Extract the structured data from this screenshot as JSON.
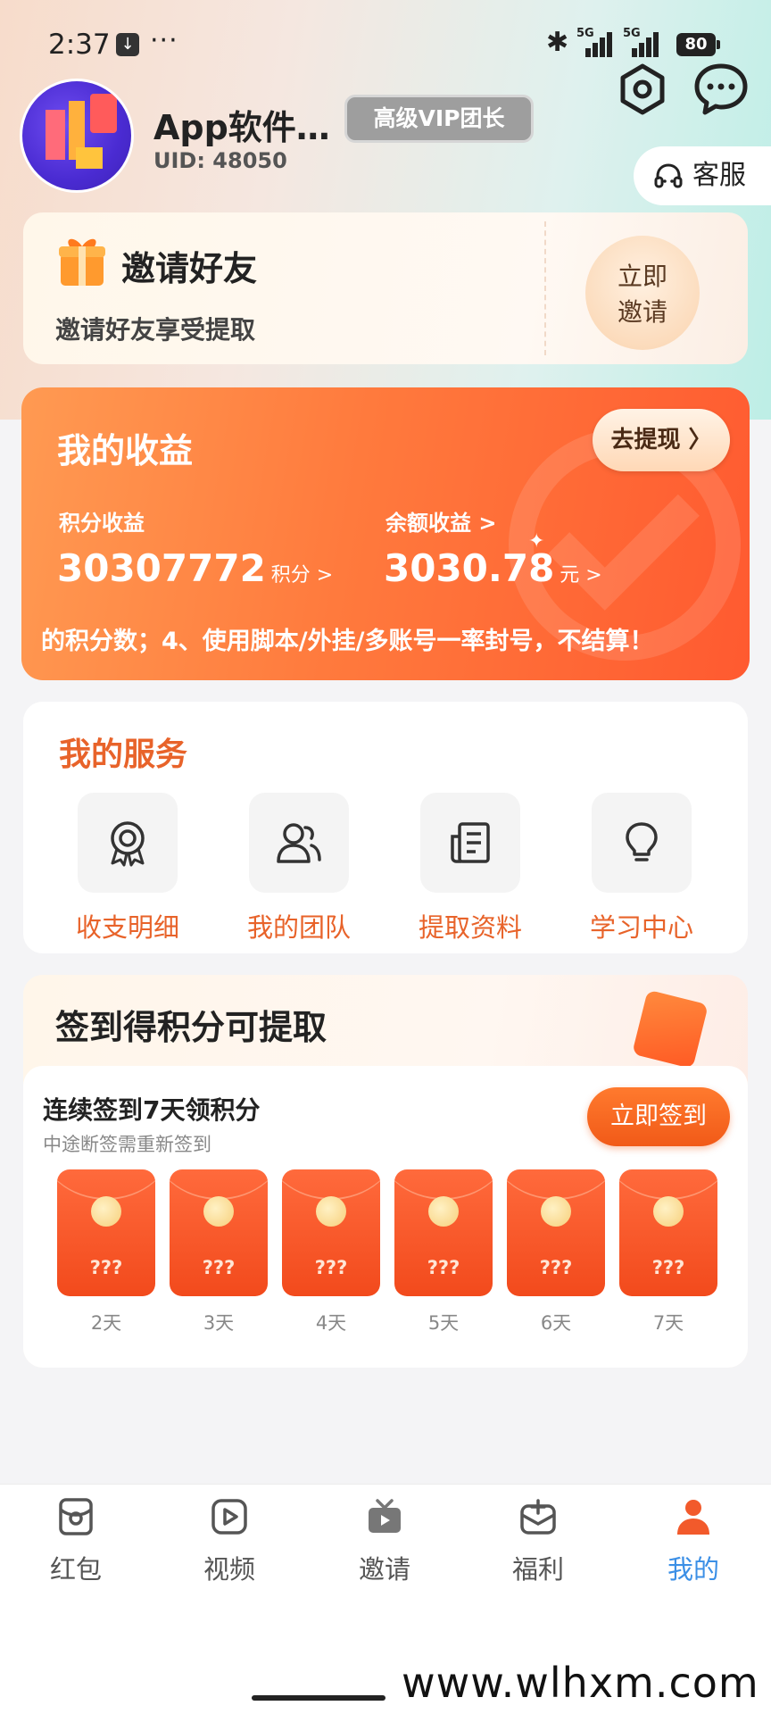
{
  "status_bar": {
    "time": "2:37",
    "download": "↓",
    "dots": "···",
    "bluetooth": "✱",
    "net1": "5G",
    "net2": "5G",
    "battery": "80"
  },
  "header": {
    "username": "App软件…",
    "uid": "UID: 48050",
    "vip_badge": "高级VIP团长",
    "service_label": "客服"
  },
  "invite": {
    "title": "邀请好友",
    "subtitle": "邀请好友享受提取",
    "button_line1": "立即",
    "button_line2": "邀请"
  },
  "earnings": {
    "title": "我的收益",
    "withdraw_label": "去提现 〉",
    "points_label": "积分收益",
    "points_value": "30307772",
    "points_unit": "积分 >",
    "balance_label": "余额收益 >",
    "balance_value": "3030.78",
    "balance_unit": "元 >",
    "marquee": "的积分数；4、使用脚本/外挂/多账号一率封号，不结算！"
  },
  "services": {
    "title": "我的服务",
    "items": [
      {
        "label": "收支明细",
        "icon": "badge-icon"
      },
      {
        "label": "我的团队",
        "icon": "team-icon"
      },
      {
        "label": "提取资料",
        "icon": "document-icon"
      },
      {
        "label": "学习中心",
        "icon": "lightbulb-icon"
      }
    ]
  },
  "signin": {
    "title": "签到得积分可提取",
    "streak_title": "连续签到7天领积分",
    "streak_sub": "中途断签需重新签到",
    "button": "立即签到",
    "days": [
      {
        "mystery": "???",
        "label": "2天"
      },
      {
        "mystery": "???",
        "label": "3天"
      },
      {
        "mystery": "???",
        "label": "4天"
      },
      {
        "mystery": "???",
        "label": "5天"
      },
      {
        "mystery": "???",
        "label": "6天"
      },
      {
        "mystery": "???",
        "label": "7天"
      }
    ]
  },
  "nav": {
    "items": [
      {
        "label": "红包",
        "icon": "red-packet-icon"
      },
      {
        "label": "视频",
        "icon": "video-icon"
      },
      {
        "label": "邀请",
        "icon": "tv-icon"
      },
      {
        "label": "福利",
        "icon": "gift-box-icon"
      },
      {
        "label": "我的",
        "icon": "profile-icon",
        "active": true
      }
    ]
  },
  "watermark": "www.wlhxm.com",
  "colors": {
    "accent_orange": "#e8632a",
    "nav_active": "#3b8fe6",
    "earn_gradient_start": "#ff9a52",
    "earn_gradient_end": "#ff5a30"
  }
}
